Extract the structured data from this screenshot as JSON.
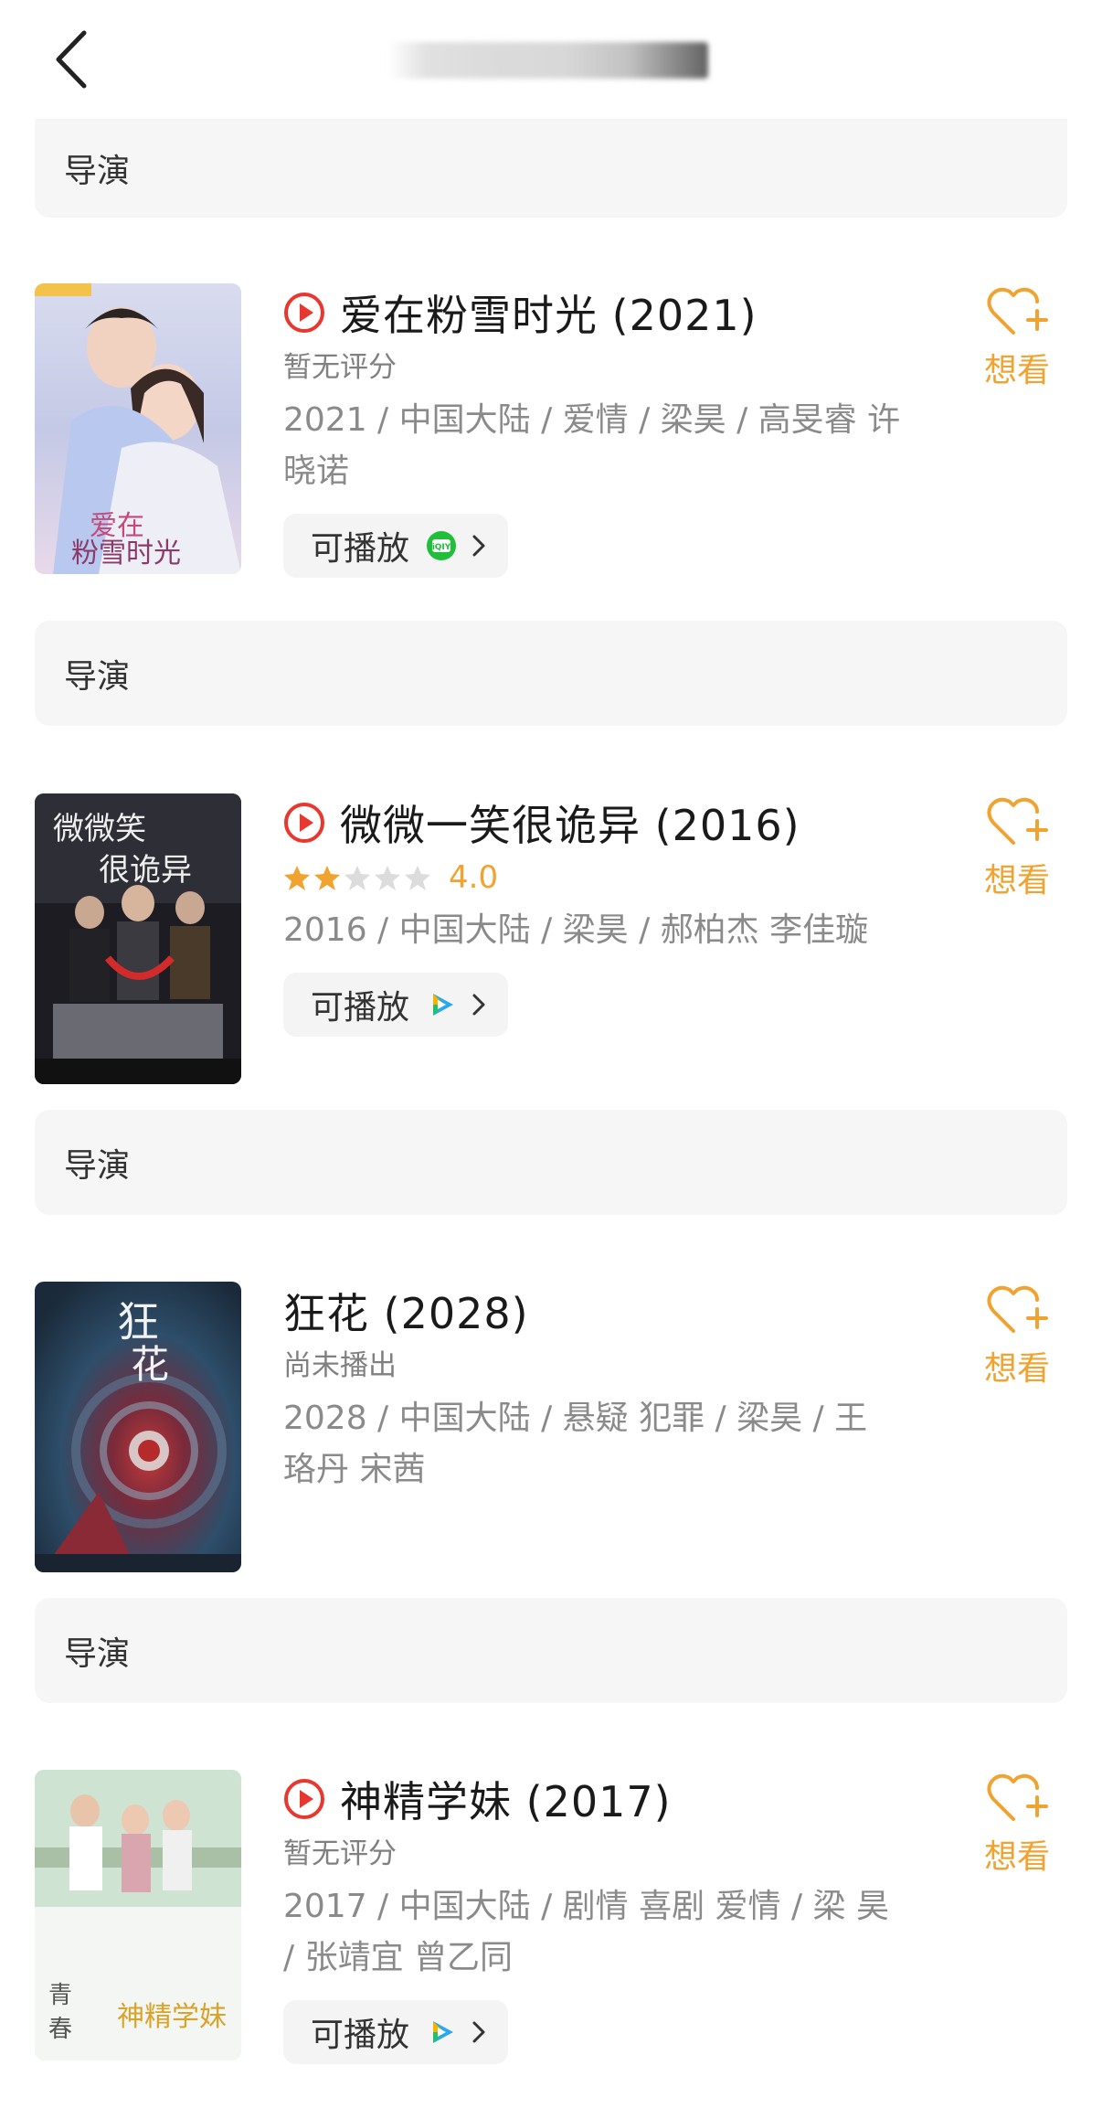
{
  "header": {
    "back_icon": "chevron-left-icon"
  },
  "director_label": "导演",
  "colors": {
    "accent": "#f0a330",
    "play_red": "#e8372f",
    "meta_gray": "#8a8a8a",
    "bar_bg": "#f6f6f6"
  },
  "movies": [
    {
      "title": "爱在粉雪时光 (2021)",
      "has_play_icon": true,
      "rating_text": "暂无评分",
      "meta": "2021 / 中国大陆 / 爱情 / 梁昊 / 高旻睿 许晓诺",
      "playable_label": "可播放",
      "platform_icon": "iqiyi-icon",
      "want_label": "想看"
    },
    {
      "title": "微微一笑很诡异 (2016)",
      "has_play_icon": true,
      "rating_stars": 2,
      "rating_score": "4.0",
      "meta": "2016 / 中国大陆 / 梁昊 / 郝柏杰 李佳璇",
      "playable_label": "可播放",
      "platform_icon": "tencent-video-icon",
      "want_label": "想看"
    },
    {
      "title": "狂花 (2028)",
      "has_play_icon": false,
      "rating_text": "尚未播出",
      "meta": "2028 / 中国大陆 / 悬疑 犯罪 / 梁昊 / 王 珞丹 宋茜",
      "want_label": "想看"
    },
    {
      "title": "神精学妹 (2017)",
      "has_play_icon": true,
      "rating_text": "暂无评分",
      "meta": "2017 / 中国大陆 / 剧情 喜剧 爱情 / 梁 昊 / 张靖宜 曾乙同",
      "playable_label": "可播放",
      "platform_icon": "tencent-video-icon",
      "want_label": "想看"
    }
  ]
}
